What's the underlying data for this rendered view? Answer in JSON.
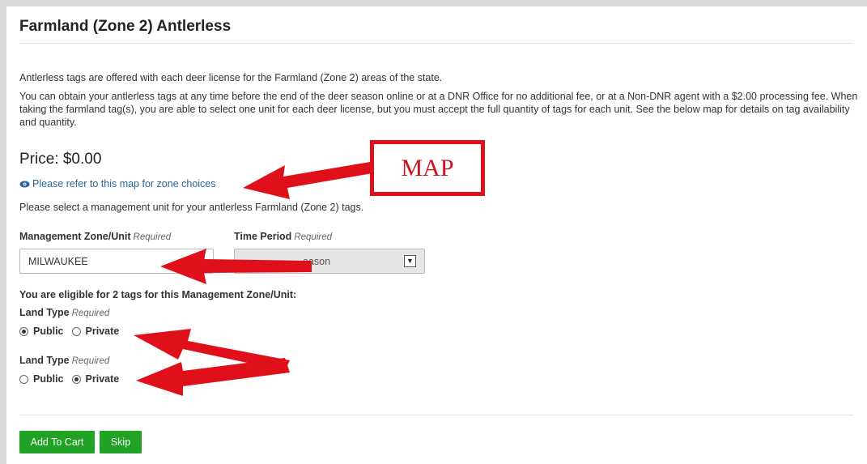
{
  "page": {
    "title": "Farmland (Zone 2) Antlerless",
    "intro": "Antlerless tags are offered with each deer license for the Farmland (Zone 2) areas of the state.",
    "details": "You can obtain your antlerless tags at any time before the end of the deer season online or at a DNR Office for no additional fee, or at a Non-DNR agent with a $2.00 processing fee. When taking the farmland tag(s), you are able to select one unit for each deer license, but you must accept the full quantity of tags for each unit. See the below map for details on tag availability and quantity.",
    "price": "Price: $0.00",
    "map_link": "Please refer to this map for zone choices",
    "select_prompt": "Please select a management unit for your antlerless Farmland (Zone 2) tags."
  },
  "form": {
    "zone_label": "Management Zone/Unit",
    "zone_required": "Required",
    "zone_value": "MILWAUKEE",
    "time_label": "Time Period",
    "time_required": "Required",
    "time_value": "eason",
    "eligible_text": "You are eligible for 2 tags for this Management Zone/Unit:",
    "land_type_label": "Land Type",
    "land_type_required": "Required",
    "tags": [
      {
        "public": "Public",
        "private": "Private",
        "selected": "Public"
      },
      {
        "public": "Public",
        "private": "Private",
        "selected": "Private"
      }
    ]
  },
  "actions": {
    "add_to_cart": "Add To Cart",
    "skip": "Skip"
  },
  "annotation": {
    "map_label": "MAP",
    "color": "#e0101a"
  },
  "icons": {
    "map_link_icon": "eye-icon",
    "select_arrow": "chevron-down-icon"
  }
}
